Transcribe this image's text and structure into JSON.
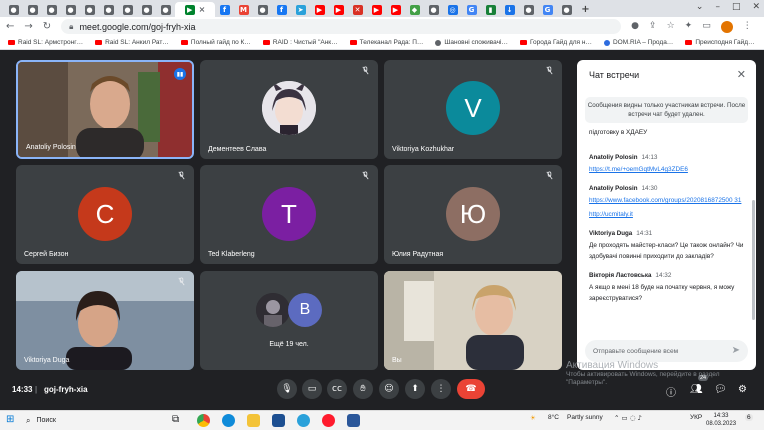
{
  "browser": {
    "url": "meet.google.com/goj-fryh-xia",
    "bookmarks": [
      "Raid SL: Армстронг…",
      "Raid SL: Анкил Рат…",
      "Полный гайд по К…",
      "RAID : Чистый \"Анк…",
      "Телеканал Рада: П…",
      "Шановні споживачі…",
      "Города Гайд для н…",
      "DOM.RIA – Прода…",
      "Преисподня Гайд…"
    ]
  },
  "tiles": [
    {
      "name": "Anatoliy Polosin"
    },
    {
      "name": "Дементеев Слава"
    },
    {
      "name": "Viktoriya Kozhukhar",
      "initial": "V",
      "color": "#0b8a9b"
    },
    {
      "name": "Сергей Бизон",
      "initial": "С",
      "color": "#c5391b"
    },
    {
      "name": "Ted Klaberleng",
      "initial": "T",
      "color": "#7b1fa2"
    },
    {
      "name": "Юлия Радутная",
      "initial": "Ю",
      "color": "#8d6e63"
    },
    {
      "name": "Viktoriya Duga"
    },
    {
      "name": "Ещё 19 чел.",
      "initial": "B",
      "color": "#5c6bc0"
    },
    {
      "name": "Вы"
    }
  ],
  "chat": {
    "title": "Чат встречи",
    "note": "Сообщения видны только участникам встречи. После встречи чат будет удален.",
    "truncated": "підготовку в ХДАЕУ",
    "messages": [
      {
        "author": "Anatoliy Polosin",
        "time": "14:13",
        "links": [
          "https://t.me/+oemGqtMvL4g3ZDE6"
        ]
      },
      {
        "author": "Anatoliy Polosin",
        "time": "14:30",
        "links": [
          "https://www.facebook.com/groups/2020816872500 31",
          "http://ucmitaly.it"
        ]
      },
      {
        "author": "Viktoriya Duga",
        "time": "14:31",
        "text": "Де проходять майстер-класи? Це також онлайн? Чи здобувачі повинні приходити до закладів?"
      },
      {
        "author": "Вікторія Ластовська",
        "time": "14:32",
        "text": "А якщо в мені 18 буде на початку червня, я можу зареєструватися?"
      }
    ],
    "input_placeholder": "Отправьте сообщение всем"
  },
  "bottom": {
    "time": "14:33",
    "code": "goj-fryh-xia",
    "participants_badge": "24"
  },
  "watermark": {
    "line1": "Активация Windows",
    "line2": "Чтобы активировать Windows, перейдите в раздел",
    "line3": "\"Параметры\"."
  },
  "taskbar": {
    "search": "Поиск",
    "weather": "8°C",
    "weather_text": "Partly sunny",
    "lang": "УКР",
    "clock_time": "14:33",
    "clock_date": "08.03.2023",
    "notif": "6"
  }
}
